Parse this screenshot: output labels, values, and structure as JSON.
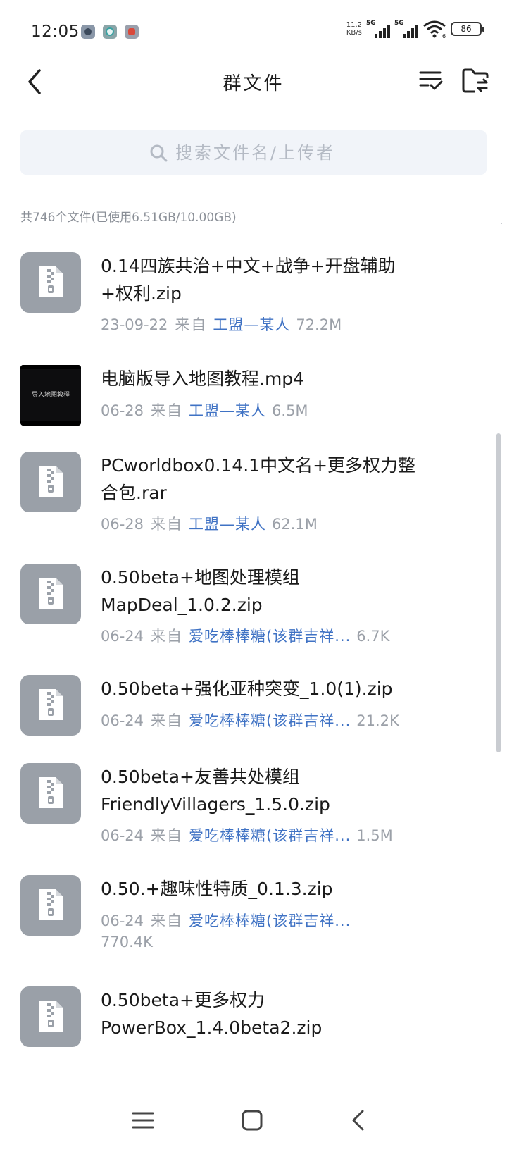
{
  "status_bar": {
    "time": "12:05",
    "net_speed_value": "11.2",
    "net_speed_unit": "KB/s",
    "signal1_label": "5G",
    "signal2_label": "5G",
    "wifi_badge": "6",
    "battery": "86"
  },
  "header": {
    "title": "群文件",
    "back_icon": "chevron-left-icon",
    "sort_icon": "list-check-icon",
    "folder_icon": "folder-transfer-icon"
  },
  "search": {
    "placeholder": "搜索文件名/上传者"
  },
  "summary": "共746个文件(已使用6.51GB/10.00GB)",
  "files": [
    {
      "type": "zip",
      "name": "0.14四族共治+中文+战争+开盘辅助+权利.zip",
      "date": "23-09-22",
      "from": "来自",
      "uploader": "工盟—某人",
      "size": "72.2M"
    },
    {
      "type": "video",
      "thumb_text": "导入地图教程",
      "name": "电脑版导入地图教程.mp4",
      "date": "06-28",
      "from": "来自",
      "uploader": "工盟—某人",
      "size": "6.5M"
    },
    {
      "type": "zip",
      "name": "PCworldbox0.14.1中文名+更多权力整合包.rar",
      "date": "06-28",
      "from": "来自",
      "uploader": "工盟—某人",
      "size": "62.1M"
    },
    {
      "type": "zip",
      "name": "0.50beta+地图处理模组MapDeal_1.0.2.zip",
      "date": "06-24",
      "from": "来自",
      "uploader": "爱吃棒棒糖(该群吉祥...",
      "size": "6.7K"
    },
    {
      "type": "zip",
      "name": "0.50beta+强化亚种突变_1.0(1).zip",
      "date": "06-24",
      "from": "来自",
      "uploader": "爱吃棒棒糖(该群吉祥...",
      "size": "21.2K"
    },
    {
      "type": "zip",
      "name": "0.50beta+友善共处模组FriendlyVillagers_1.5.0.zip",
      "date": "06-24",
      "from": "来自",
      "uploader": "爱吃棒棒糖(该群吉祥...",
      "size": "1.5M"
    },
    {
      "type": "zip",
      "name": "0.50.+趣味性特质_0.1.3.zip",
      "date": "06-24",
      "from": "来自",
      "uploader": "爱吃棒棒糖(该群吉祥...",
      "size": "770.4K"
    },
    {
      "type": "zip",
      "name": "0.50beta+更多权力PowerBox_1.4.0beta2.zip",
      "date": "",
      "from": "",
      "uploader": "",
      "size": ""
    }
  ],
  "nav": {
    "menu_icon": "menu-icon",
    "home_icon": "home-square-icon",
    "back_icon": "back-triangle-icon"
  },
  "colors": {
    "uploader": "#3f72c4",
    "meta": "#9ba0a8",
    "thumb": "#9aa0a8",
    "search_bg": "#f1f4f9"
  }
}
